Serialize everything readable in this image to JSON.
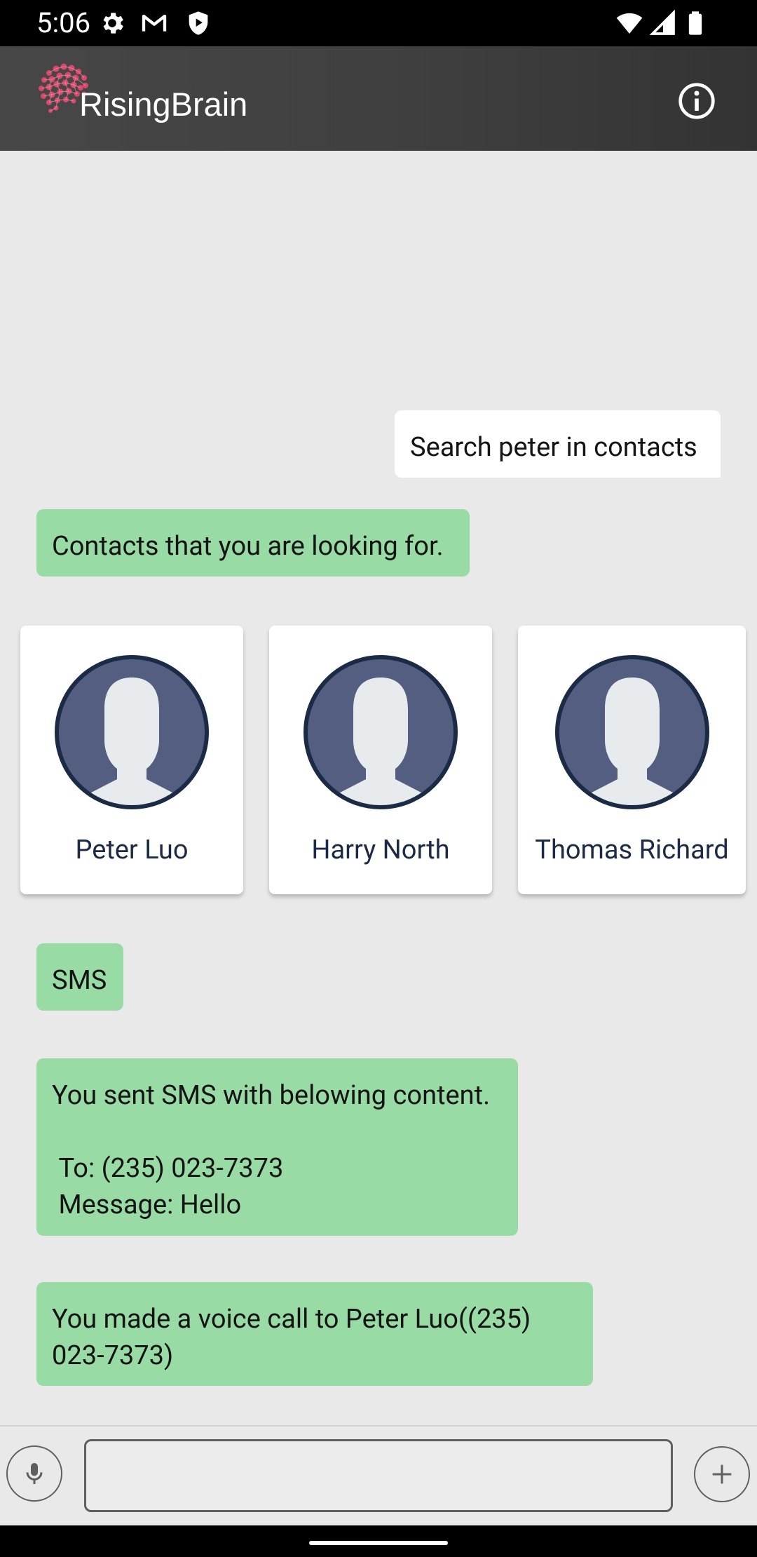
{
  "status_bar": {
    "time": "5:06",
    "left_icons": [
      "settings-icon",
      "gmail-icon",
      "play-protect-icon"
    ],
    "right_icons": [
      "wifi-icon",
      "signal-icon",
      "battery-icon"
    ]
  },
  "app_bar": {
    "logo_icon": "brain-logo-icon",
    "title": "RisingBrain",
    "info_icon": "info-icon"
  },
  "chat": {
    "user_message": "Search peter in contacts",
    "bot_intro": "Contacts that you are looking for.",
    "contacts": [
      {
        "name": "Peter Luo"
      },
      {
        "name": "Harry North"
      },
      {
        "name": "Thomas Richard"
      }
    ],
    "sms_label": "SMS",
    "sms_message": "You sent SMS with belowing content.\n\n To: (235) 023-7373\n Message: Hello",
    "call_message": "You made a voice call to Peter Luo((235) 023-7373)"
  },
  "input_bar": {
    "mic_icon": "microphone-icon",
    "input_value": "",
    "add_icon": "plus-icon"
  },
  "colors": {
    "app_bar": "#444444",
    "chat_background": "#e9e9e9",
    "bot_bubble": "#99dba4",
    "user_bubble": "#ffffff",
    "avatar_fill": "#535e80",
    "avatar_border": "#1c2b45",
    "logo_accent": "#d9486a"
  }
}
